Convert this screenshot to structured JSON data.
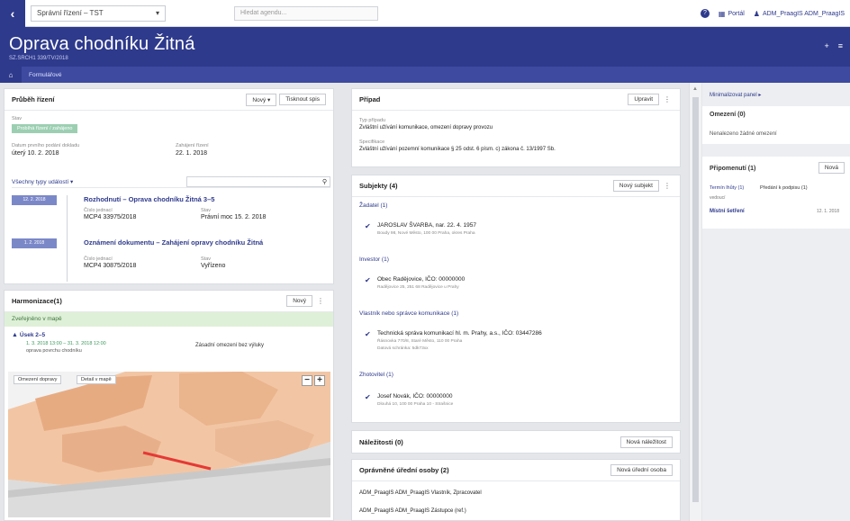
{
  "topbar": {
    "back_icon": "arrow-left",
    "app_selector": "Správní řízení – TST",
    "search_placeholder": "Hledat agendu...",
    "help": "?",
    "menu_label": "Portál",
    "user_label": "ADM_PraagIS ADM_PraagIS"
  },
  "header": {
    "title": "Oprava chodníku Žitná",
    "subtitle": "SZ.SRCH1 339/TV/2018",
    "actions": [
      "+",
      "≡"
    ]
  },
  "tabs": {
    "home_icon": "home",
    "items": [
      "Formulářové"
    ]
  },
  "prubeh": {
    "title": "Průběh řízení",
    "btn_new": "Nový ▾",
    "btn_print": "Tisknout spis",
    "state_label": "Stav",
    "state_value": "Probíhá řízení / zahájeno",
    "date_label": "Datum prvního podání dokladu",
    "date_value": "úterý 10. 2. 2018",
    "cat_label": "Zahájení řízení",
    "cat_value": "22. 1. 2018",
    "filter_link": "Všechny typy událostí ▾",
    "entries": [
      {
        "date": "12. 2. 2018",
        "title": "Rozhodnutí – Oprava chodníku Žitná 3–5",
        "lbl1": "Číslo jednací",
        "val1": "MCP4 33975/2018",
        "lbl2": "Stav",
        "val2": "Právní moc 15. 2. 2018"
      },
      {
        "date": "1. 2. 2018",
        "title": "Oznámení dokumentu – Zahájení opravy chodníku Žitná",
        "lbl1": "Číslo jednací",
        "val1": "MCP4 30875/2018",
        "lbl2": "Stav",
        "val2": "Vyřízeno"
      }
    ]
  },
  "harmonogram": {
    "title": "Harmonizace(1)",
    "btn_new": "Nový",
    "info": "Zveřejněno v mapě",
    "item_title": "Úsek 2–5",
    "item_time": "1. 3. 2018 13:00 – 31. 3. 2018 12:00",
    "item_desc": "oprava povrchu chodníku",
    "item_right": "Zásadní omezení bez výluky",
    "map_btn1": "Omezení dopravy",
    "map_btn2": "Detail v mapě",
    "zoom_out": "−",
    "zoom_in": "+"
  },
  "pripad": {
    "title": "Případ",
    "btn_edit": "Upravit",
    "lbl1": "Typ případu",
    "val1": "Zvláštní užívání komunikace, omezení dopravy provozu",
    "lbl2": "Specifikace",
    "val2": "Zvláštní užívání pozemní komunikace § 25 odst. 6 písm. c) zákona č. 13/1997 Sb."
  },
  "subjekty": {
    "title": "Subjekty (4)",
    "btn_new": "Nový subjekt",
    "groups": [
      {
        "label": "Žadatel (1)",
        "name": "JAROSLAV ŠVARBA, nar. 22. 4. 1957",
        "details": [
          "Boudy 98, Nové Město, 100 00 Praha, okres Praha"
        ]
      },
      {
        "label": "Investor (1)",
        "name": "Obec Radějovice, IČO: 00000000",
        "details": [
          "Radějovice 25, 251 68 Radějovice u Prahy"
        ]
      },
      {
        "label": "Vlastník nebo správce komunikace (1)",
        "name": "Technická správa komunikací hl. m. Prahy, a.s., IČO: 03447286",
        "details": [
          "Řásnovka 770/8, Staré Město, 110 00 Praha",
          "Datová schránka: 5dk73xx"
        ]
      },
      {
        "label": "Zhotovitel (1)",
        "name": "Josef Novák, IČO: 00000000",
        "details": [
          "Dlouhá 10, 100 00 Praha 10 - Strašnice"
        ]
      }
    ]
  },
  "nalezitosti": {
    "title": "Náležitosti (0)",
    "btn_new": "Nová náležitost"
  },
  "osoby": {
    "title": "Oprávněné úřední osoby (2)",
    "btn_new": "Nová úřední osoba",
    "rows": [
      "ADM_PraagIS ADM_PraagIS Vlastník, Zpracovatel",
      "ADM_PraagIS ADM_PraagIS Zástupce (ref.)"
    ]
  },
  "right_panel": {
    "top_link": "Minimalizovat panel ▸",
    "omezeni_title": "Omezení (0)",
    "omezeni_text": "Nenalezeno žádné omezení",
    "pripom_title": "Připomenutí (1)",
    "pripom_btn": "Nová",
    "pripom_row_link": "Termín lhůty (1)",
    "pripom_row_text": "Předání k podpisu (1)",
    "pripom_row_sub": "vedoucí",
    "pripom_item": "Místní šetření",
    "pripom_item_date": "12. 1. 2018"
  }
}
